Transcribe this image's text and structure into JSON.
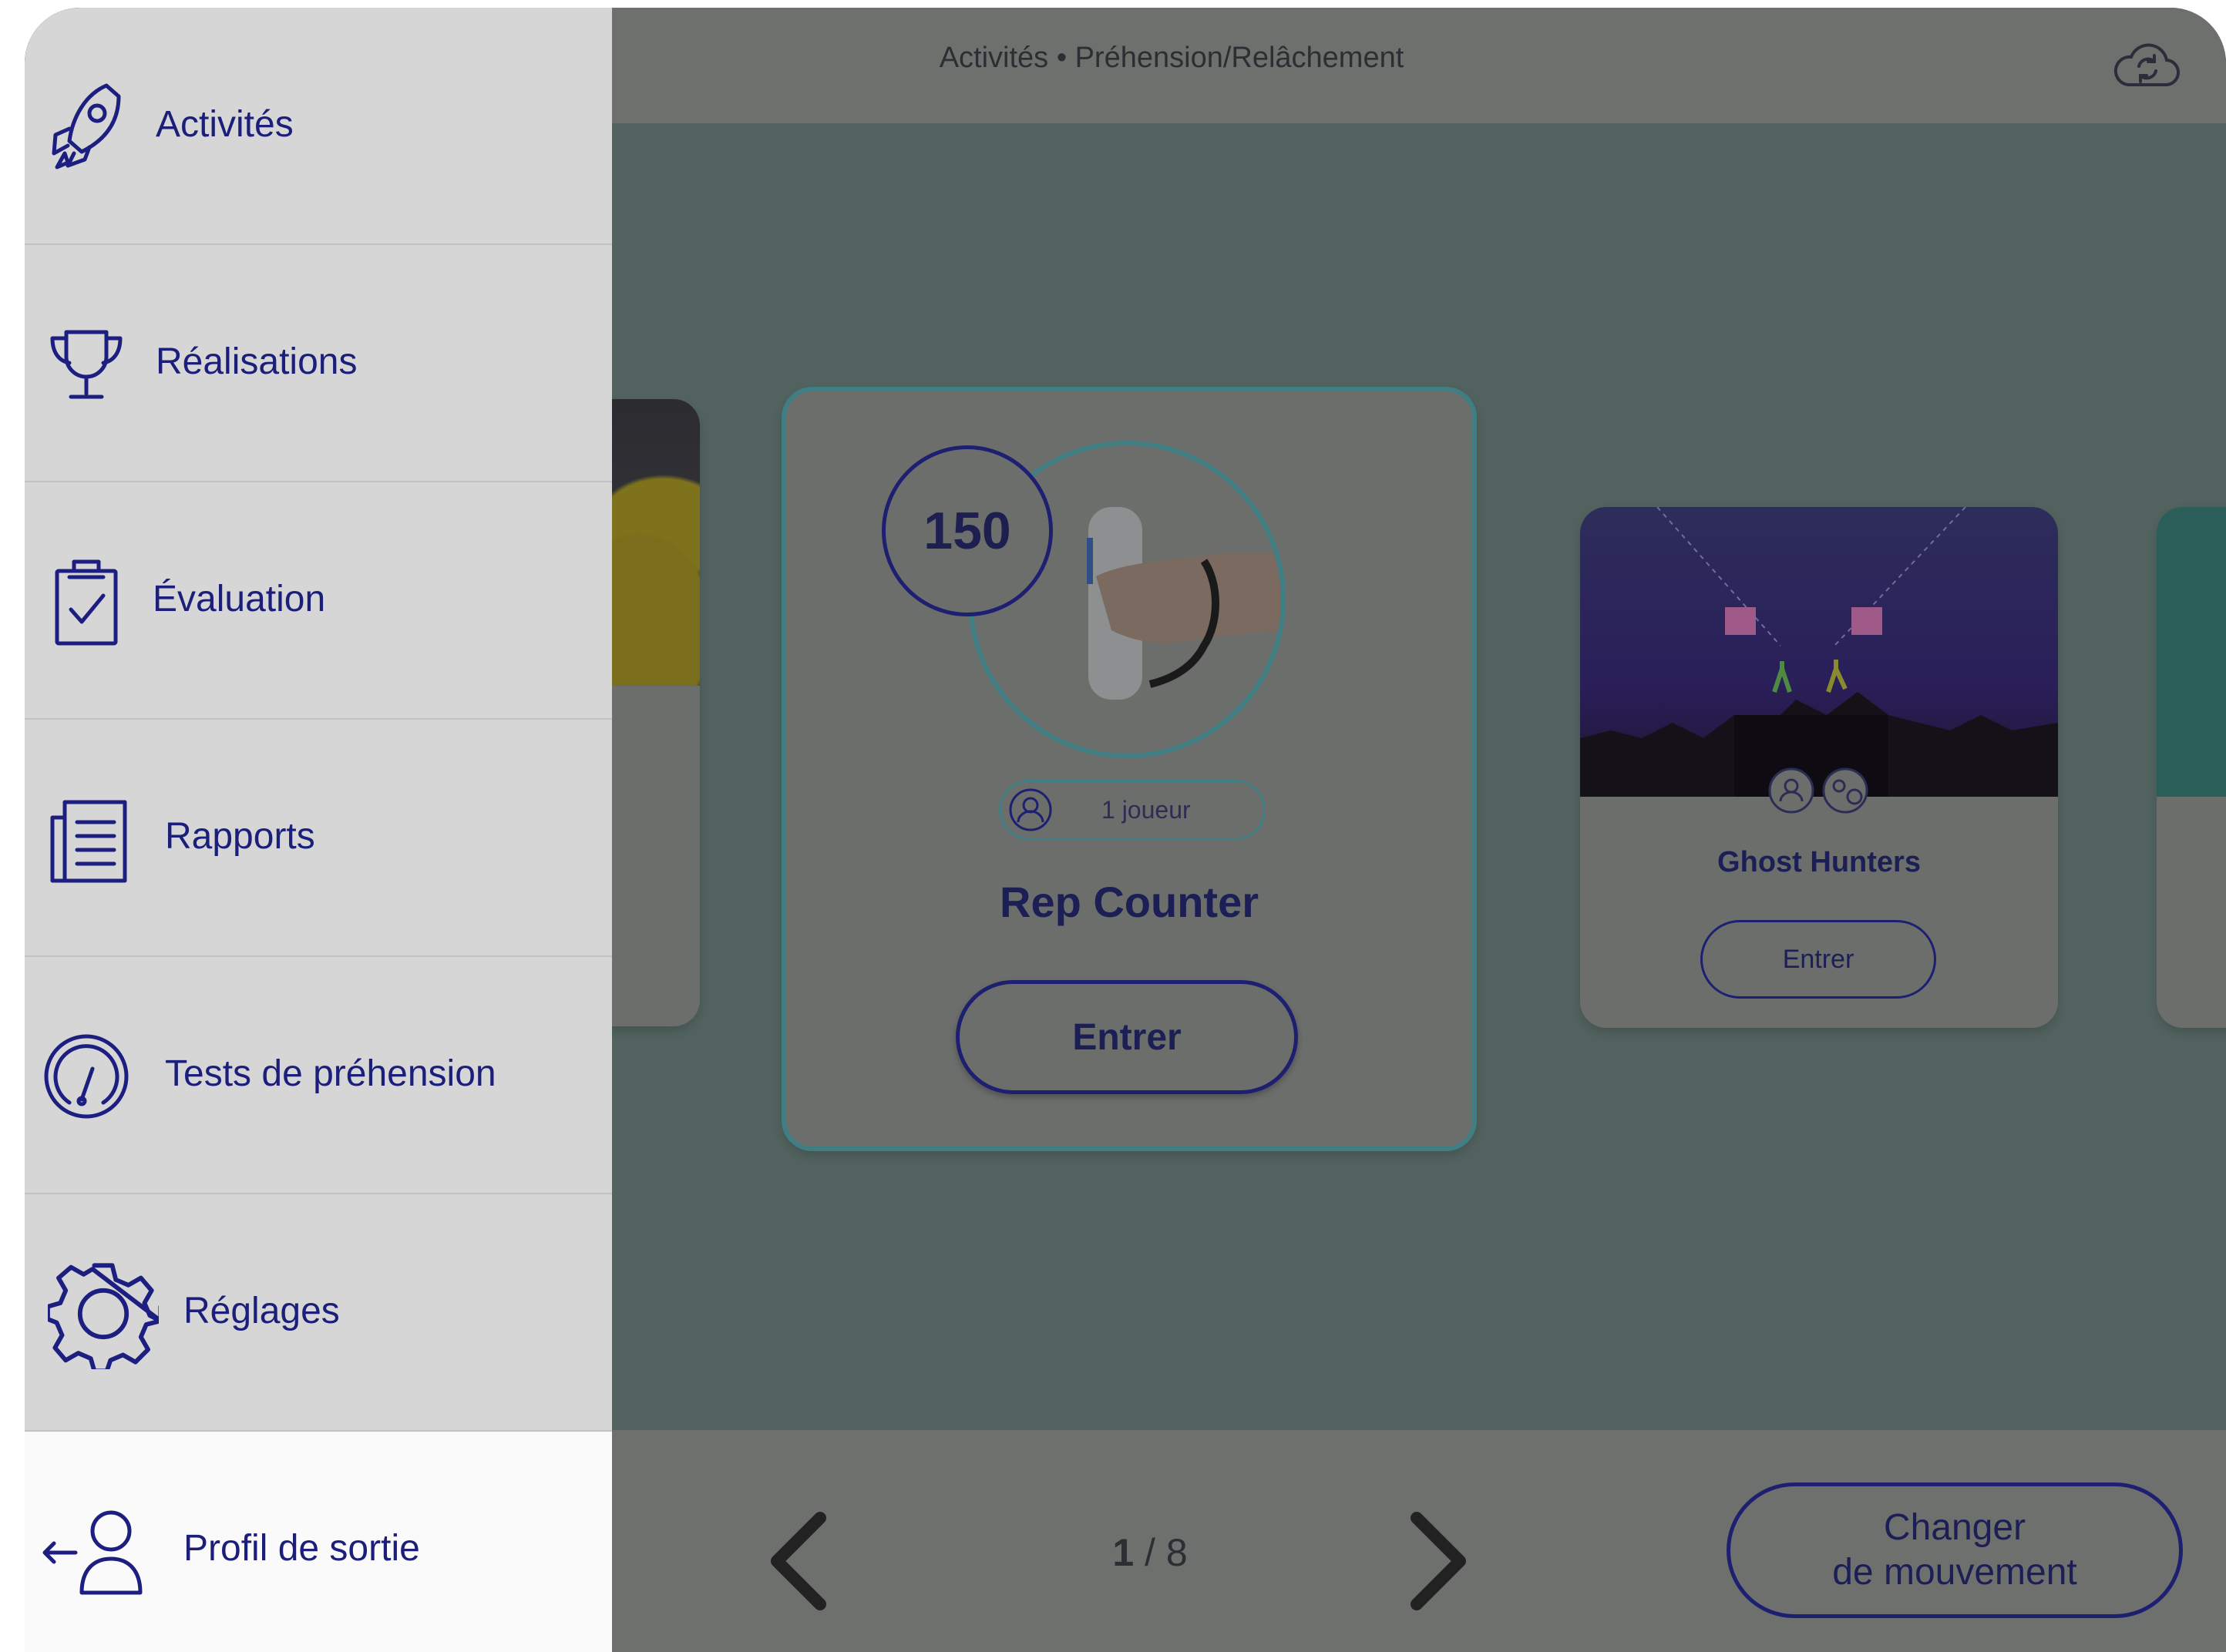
{
  "header": {
    "title": "Activités • Préhension/Relâchement",
    "sync_icon": "cloud-sync-icon"
  },
  "drawer": {
    "items": [
      {
        "label": "Activités",
        "icon": "rocket-icon"
      },
      {
        "label": "Réalisations",
        "icon": "trophy-icon"
      },
      {
        "label": "Évaluation",
        "icon": "clipboard-check-icon"
      },
      {
        "label": "Rapports",
        "icon": "report-icon"
      },
      {
        "label": "Tests de préhension",
        "icon": "gauge-icon"
      },
      {
        "label": "Réglages",
        "icon": "gear-icon"
      },
      {
        "label": "Profil de sortie",
        "icon": "profile-exit-icon",
        "selected": true
      }
    ]
  },
  "cards": {
    "main": {
      "score": "150",
      "players": "1 joueur",
      "title": "Rep Counter",
      "enter": "Entrer"
    },
    "ghost": {
      "title": "Ghost Hunters",
      "enter": "Entrer"
    }
  },
  "pager": {
    "current": "1",
    "separator": "/",
    "total": "8"
  },
  "footer": {
    "change_line1": "Changer",
    "change_line2": "de mouvement"
  },
  "colors": {
    "brand": "#1d1f80",
    "accent_teal": "#3f7f83",
    "drawer_bg": "#d6d6d6",
    "overlay": "#53605c"
  }
}
